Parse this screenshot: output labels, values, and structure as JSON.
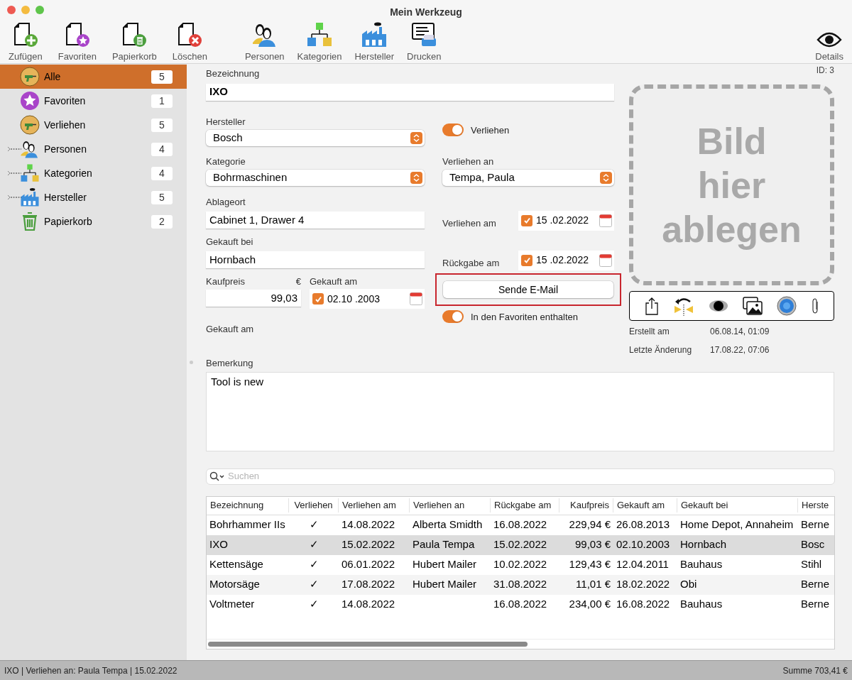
{
  "window": {
    "title": "Mein Werkzeug"
  },
  "toolbar": {
    "left": [
      {
        "label": "Zufügen",
        "kind": "add"
      },
      {
        "label": "Favoriten",
        "kind": "favorite"
      },
      {
        "label": "Papierkorb",
        "kind": "trash"
      },
      {
        "label": "Löschen",
        "kind": "delete"
      }
    ],
    "middle": [
      {
        "label": "Personen",
        "kind": "persons"
      },
      {
        "label": "Kategorien",
        "kind": "categories"
      },
      {
        "label": "Hersteller",
        "kind": "factory"
      },
      {
        "label": "Drucken",
        "kind": "print"
      }
    ],
    "right": [
      {
        "label": "Details",
        "kind": "eye"
      }
    ]
  },
  "sidebar": {
    "items": [
      {
        "label": "Alle",
        "count": "5",
        "kind": "drill",
        "has_children": false,
        "selected": true
      },
      {
        "label": "Favoriten",
        "count": "1",
        "kind": "star",
        "has_children": false,
        "selected": false
      },
      {
        "label": "Verliehen",
        "count": "5",
        "kind": "drill",
        "has_children": false,
        "selected": false
      },
      {
        "label": "Personen",
        "count": "4",
        "kind": "persons",
        "has_children": true,
        "selected": false
      },
      {
        "label": "Kategorien",
        "count": "4",
        "kind": "categories",
        "has_children": true,
        "selected": false
      },
      {
        "label": "Hersteller",
        "count": "5",
        "kind": "factory",
        "has_children": true,
        "selected": false
      },
      {
        "label": "Papierkorb",
        "count": "2",
        "kind": "trash",
        "has_children": false,
        "selected": false
      }
    ]
  },
  "form": {
    "name": {
      "label": "Bezeichnung",
      "value": "IXO"
    },
    "manufacturer": {
      "label": "Hersteller",
      "value": "Bosch"
    },
    "category": {
      "label": "Kategorie",
      "value": "Bohrmaschinen"
    },
    "location": {
      "label": "Ablageort",
      "value": "Cabinet 1, Drawer 4"
    },
    "shop": {
      "label": "Gekauft bei",
      "value": "Hornbach"
    },
    "price": {
      "label": "Kaufpreis",
      "currency": "€",
      "value": "99,03"
    },
    "purchase_date": {
      "label": "Gekauft am",
      "checked": true,
      "value": "02.10 .2003"
    },
    "purchase_note": {
      "label": "Gekauft am"
    },
    "lent_toggle": {
      "label": "Verliehen",
      "on": true
    },
    "lent_to": {
      "label": "Verliehen an",
      "value": "Tempa, Paula"
    },
    "lent_on": {
      "label": "Verliehen am",
      "checked": true,
      "value": "15 .02.2022"
    },
    "return_on": {
      "label": "Rückgabe am",
      "checked": true,
      "value": "15 .02.2022"
    },
    "email_button": {
      "label": "Sende E-Mail",
      "highlighted": true
    },
    "favorite_toggle": {
      "label": "In den Favoriten enthalten",
      "on": true
    },
    "remark": {
      "label": "Bemerkung",
      "value": "Tool is new"
    }
  },
  "image": {
    "id": "ID: 3",
    "drop_text_lines": [
      "Bild",
      "hier",
      "ablegen"
    ]
  },
  "meta": [
    {
      "label": "Erstellt am",
      "value": "06.08.14, 01:09"
    },
    {
      "label": "Letzte Änderung",
      "value": "17.08.22, 07:06"
    }
  ],
  "search": {
    "placeholder": "Suchen"
  },
  "table": {
    "columns": [
      "Bezeichnung",
      "Verliehen",
      "Verliehen am",
      "Verliehen an",
      "Rückgabe am",
      "Kaufpreis",
      "Gekauft am",
      "Gekauft bei",
      "Herste"
    ],
    "rows": [
      {
        "selected": false,
        "cells": [
          "Bohrhammer IIs",
          "✓",
          "14.08.2022",
          "Alberta Smidth",
          "16.08.2022",
          "229,94 €",
          "26.08.2013",
          "Home Depot, Annaheim",
          "Berne"
        ]
      },
      {
        "selected": true,
        "cells": [
          "IXO",
          "✓",
          "15.02.2022",
          "Paula Tempa",
          "15.02.2022",
          "99,03 €",
          "02.10.2003",
          "Hornbach",
          "Bosc"
        ]
      },
      {
        "selected": false,
        "cells": [
          "Kettensäge",
          "✓",
          "06.01.2022",
          "Hubert Mailer",
          "10.02.2022",
          "129,43 €",
          "12.04.2011",
          "Bauhaus",
          "Stihl"
        ]
      },
      {
        "selected": false,
        "cells": [
          "Motorsäge",
          "✓",
          "17.08.2022",
          "Hubert Mailer",
          "31.08.2022",
          "11,01 €",
          "18.02.2022",
          "Obi",
          "Berne"
        ]
      },
      {
        "selected": false,
        "cells": [
          "Voltmeter",
          "✓",
          "14.08.2022",
          "",
          "16.08.2022",
          "234,00 €",
          "16.08.2022",
          "Bauhaus",
          "Berne"
        ]
      }
    ]
  },
  "status_bar": {
    "left": "IXO | Verliehen an: Paula Tempa | 15.02.2022",
    "right": "Summe 703,41 €"
  }
}
